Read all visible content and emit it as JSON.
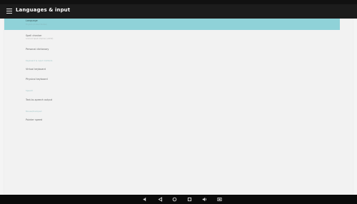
{
  "app_bar": {
    "title": "Languages & input"
  },
  "settings": [
    {
      "label": "Language",
      "summary": "English (United States)",
      "selected": true
    },
    {
      "label": "Spell checker",
      "summary": "Android Spell Checker (AOSP)"
    },
    {
      "label": "Personal dictionary"
    }
  ],
  "sections": [
    {
      "header": "Keyboard & input methods",
      "items": [
        {
          "label": "Virtual keyboard"
        },
        {
          "label": "Physical keyboard"
        }
      ]
    },
    {
      "header": "Speech",
      "items": [
        {
          "label": "Text-to-speech output"
        }
      ]
    },
    {
      "header": "Mouse/trackpad",
      "items": [
        {
          "label": "Pointer speed"
        }
      ]
    }
  ],
  "nav_bar": {
    "buttons": [
      "volume-down-icon",
      "back-icon",
      "home-icon",
      "recents-icon",
      "volume-up-icon",
      "screenshot-icon"
    ]
  },
  "colors": {
    "accent": "#8fd2d8",
    "app_bar": "#1c1c1c",
    "nav_bar": "#0a0a0a"
  }
}
